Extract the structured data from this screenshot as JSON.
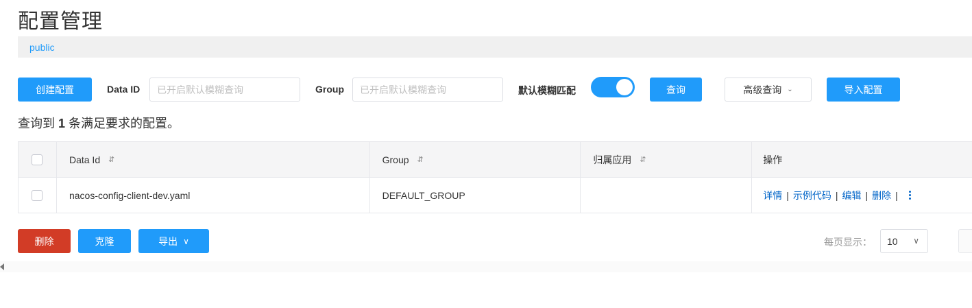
{
  "page": {
    "title": "配置管理"
  },
  "namespace": {
    "current": "public"
  },
  "toolbar": {
    "create_label": "创建配置",
    "data_id_label": "Data ID",
    "data_id_placeholder": "已开启默认模糊查询",
    "group_label": "Group",
    "group_placeholder": "已开启默认模糊查询",
    "fuzzy_label": "默认模糊匹配",
    "fuzzy_enabled": true,
    "query_label": "查询",
    "advanced_label": "高级查询",
    "import_label": "导入配置"
  },
  "result": {
    "prefix": "查询到",
    "count": "1",
    "suffix": "条满足要求的配置。"
  },
  "table": {
    "headers": {
      "data_id": "Data Id",
      "group": "Group",
      "app": "归属应用",
      "actions": "操作"
    },
    "rows": [
      {
        "data_id": "nacos-config-client-dev.yaml",
        "group": "DEFAULT_GROUP",
        "app": "",
        "actions": {
          "detail": "详情",
          "sample": "示例代码",
          "edit": "编辑",
          "delete": "删除"
        }
      }
    ],
    "separator": "|"
  },
  "footer": {
    "delete_label": "删除",
    "clone_label": "克隆",
    "export_label": "导出",
    "page_size_label": "每页显示：",
    "page_size_value": "10"
  },
  "colors": {
    "primary": "#209bfa",
    "danger": "#d23c26",
    "link": "#0064c8"
  },
  "icons": {
    "sort": "sort-icon",
    "dropdown": "chevron-down-icon",
    "more": "more-vertical-icon"
  }
}
